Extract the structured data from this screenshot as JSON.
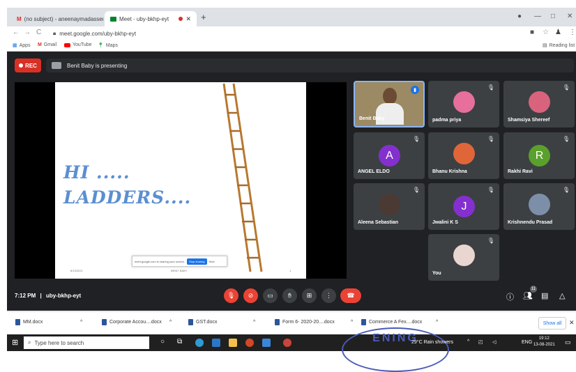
{
  "browser": {
    "tabs": [
      {
        "label": "(no subject) - aneenaymadassery"
      },
      {
        "label": "Meet - uby-bkhp-eyt"
      }
    ],
    "url": "meet.google.com/uby-bkhp-eyt",
    "bookmarks": [
      "Apps",
      "Gmail",
      "YouTube",
      "Maps"
    ],
    "reading_list": "Reading list"
  },
  "meet": {
    "rec_label": "REC",
    "presenting_text": "Benit Baby is presenting",
    "slide": {
      "line1": "HI .....",
      "line2": "LADDERS....",
      "share_notice": "meet.google.com is sharing your screen.",
      "stop_sharing": "Stop sharing",
      "hide": "Hide",
      "footer_date": "8/13/2021",
      "footer_name": "BENIT BABY",
      "footer_page": "1"
    },
    "participants": [
      {
        "name": "Benit Baby"
      },
      {
        "name": "padma priya"
      },
      {
        "name": "Shamsiya Shereef"
      },
      {
        "name": "ANGEL ELDO",
        "initial": "A"
      },
      {
        "name": "Bhanu Krishna"
      },
      {
        "name": "Rakhi Ravi",
        "initial": "R"
      },
      {
        "name": "Aleena Sebastian"
      },
      {
        "name": "Jwalini K S",
        "initial": "J"
      },
      {
        "name": "Krishnendu Prasad"
      },
      {
        "name": "You"
      }
    ],
    "time": "7:12 PM",
    "separator": "|",
    "meeting_code": "uby-bkhp-eyt",
    "participant_count": "11",
    "colors": {
      "accent_green": "#5aa02c",
      "accent_purple": "#8430ce",
      "red": "#ea4335"
    }
  },
  "downloads": {
    "files": [
      "MM.docx",
      "Corporate Accou....docx",
      "GST.docx",
      "Form 6- 2020-20....docx",
      "Commerce A Fex....docx"
    ],
    "show_all": "Show all"
  },
  "taskbar": {
    "search_placeholder": "Type here to search",
    "weather": "29°C Rain showers",
    "lang": "ENG",
    "time": "19:12",
    "date": "13-08-2021",
    "stamp": "ENING"
  }
}
